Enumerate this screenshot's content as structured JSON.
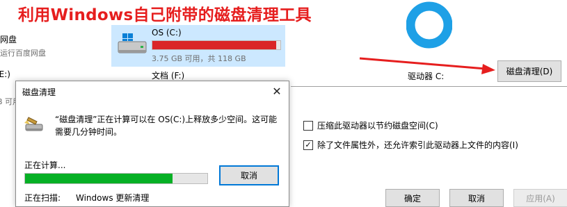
{
  "caption": "利用Windows自己附带的磁盘清理工具",
  "explorer": {
    "left_items": [
      {
        "name": "网盘",
        "sub": "运行百度网盘"
      },
      {
        "name": "(E:)",
        "sub": "B 可用"
      }
    ],
    "c_drive": {
      "name": "OS (C:)",
      "sub": "3.75 GB 可用，共 118 GB",
      "used_fraction": 0.968,
      "bar_color": "#da2626"
    },
    "f_drive": {
      "name": "文档 (F:)"
    }
  },
  "dialog": {
    "title": "磁盘清理",
    "close": "✕",
    "message": "“磁盘清理”正在计算可以在 OS(C:)上释放多少空间。这可能需要几分钟时间。",
    "calculating": "正在计算...",
    "progress_fraction": 0.81,
    "progress_color": "#06b025",
    "cancel": "取消",
    "scanning_label": "正在扫描:",
    "scanning_value": "Windows 更新清理"
  },
  "properties": {
    "drive_label": "驱动器 C:",
    "cleanup_button": "磁盘清理(D)",
    "compress_label": "压缩此驱动器以节约磁盘空间(C)",
    "compress_checked": false,
    "index_label": "除了文件属性外，还允许索引此驱动器上文件的内容(I)",
    "index_checked": true,
    "check_mark": "✓",
    "ok": "确定",
    "cancel": "取消",
    "apply": "应用(A)"
  },
  "colors": {
    "accent": "#0078d7",
    "caption": "#e61e1e",
    "donut": "#1ea0e6"
  }
}
